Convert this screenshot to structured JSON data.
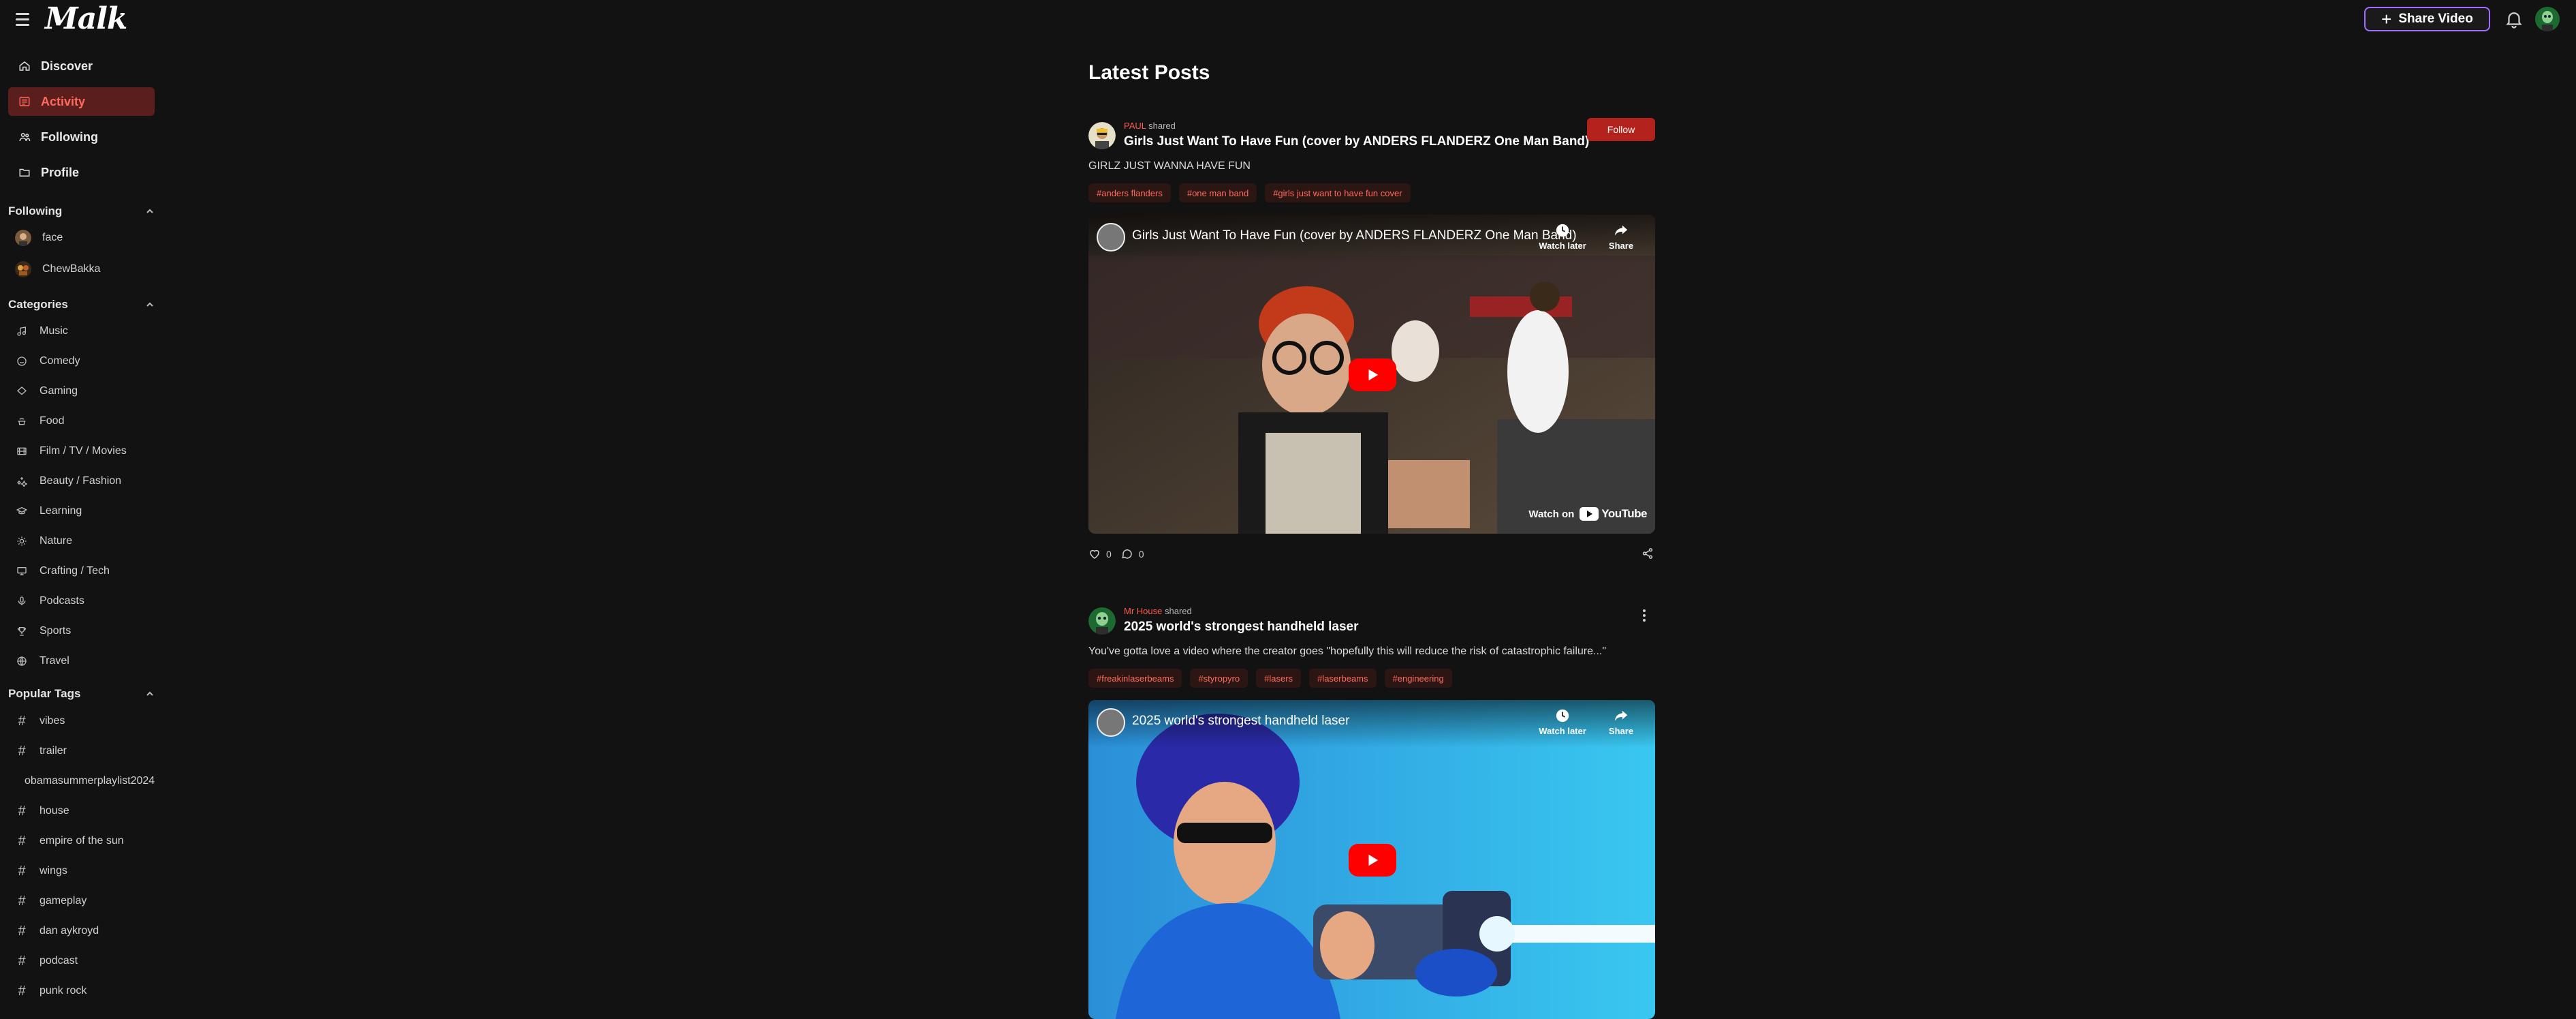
{
  "app": {
    "logo": "Malk"
  },
  "header": {
    "share_video_label": "Share Video"
  },
  "sidebar": {
    "nav": [
      {
        "label": "Discover",
        "icon": "home-icon"
      },
      {
        "label": "Activity",
        "icon": "activity-icon",
        "active": true
      },
      {
        "label": "Following",
        "icon": "users-icon"
      },
      {
        "label": "Profile",
        "icon": "folder-icon"
      }
    ],
    "following_title": "Following",
    "following": [
      {
        "name": "face"
      },
      {
        "name": "ChewBakka"
      }
    ],
    "categories_title": "Categories",
    "categories": [
      {
        "label": "Music",
        "icon": "music-note-icon"
      },
      {
        "label": "Comedy",
        "icon": "smile-icon"
      },
      {
        "label": "Gaming",
        "icon": "gamepad-icon"
      },
      {
        "label": "Food",
        "icon": "food-icon"
      },
      {
        "label": "Film / TV / Movies",
        "icon": "film-icon"
      },
      {
        "label": "Beauty / Fashion",
        "icon": "sparkles-icon"
      },
      {
        "label": "Learning",
        "icon": "graduation-cap-icon"
      },
      {
        "label": "Nature",
        "icon": "sun-icon"
      },
      {
        "label": "Crafting / Tech",
        "icon": "monitor-icon"
      },
      {
        "label": "Podcasts",
        "icon": "microphone-icon"
      },
      {
        "label": "Sports",
        "icon": "trophy-icon"
      },
      {
        "label": "Travel",
        "icon": "globe-icon"
      }
    ],
    "tags_title": "Popular Tags",
    "tags": [
      {
        "label": "vibes",
        "hash": "#"
      },
      {
        "label": "trailer",
        "hash": "#"
      },
      {
        "label": "obamasummerplaylist2024",
        "hash": ""
      },
      {
        "label": "house",
        "hash": "#"
      },
      {
        "label": "empire of the sun",
        "hash": "#"
      },
      {
        "label": "wings",
        "hash": "#"
      },
      {
        "label": "gameplay",
        "hash": "#"
      },
      {
        "label": "dan aykroyd",
        "hash": "#"
      },
      {
        "label": "podcast",
        "hash": "#"
      },
      {
        "label": "punk rock",
        "hash": "#"
      }
    ]
  },
  "main": {
    "title": "Latest Posts",
    "posts": [
      {
        "user": "PAUL",
        "shared": "shared",
        "title": "Girls Just Want To Have Fun (cover by ANDERS FLANDERZ One Man Band)",
        "follow_label": "Follow",
        "description": "GIRLZ JUST WANNA HAVE FUN",
        "tags": [
          "#anders flanders",
          "#one man band",
          "#girls just want to have fun cover"
        ],
        "video": {
          "title": "Girls Just Want To Have Fun (cover by ANDERS FLANDERZ One Man Band)",
          "watch_later": "Watch later",
          "share": "Share",
          "watch_on": "Watch on",
          "youtube": "YouTube"
        },
        "likes": "0",
        "comments": "0"
      },
      {
        "user": "Mr House",
        "shared": "shared",
        "title": "2025 world's strongest handheld laser",
        "description": "You've gotta love a video where the creator goes \"hopefully this will reduce the risk of catastrophic failure...\"",
        "tags": [
          "#freakinlaserbeams",
          "#styropyro",
          "#lasers",
          "#laserbeams",
          "#engineering"
        ],
        "video": {
          "title": "2025 world's strongest handheld laser",
          "watch_later": "Watch later",
          "share": "Share"
        }
      }
    ]
  },
  "colors": {
    "accent": "#ff5c4d",
    "active_bg": "#5a1f1d",
    "follow": "#b3221c",
    "share_border": "#a26cff",
    "background": "#121212"
  }
}
